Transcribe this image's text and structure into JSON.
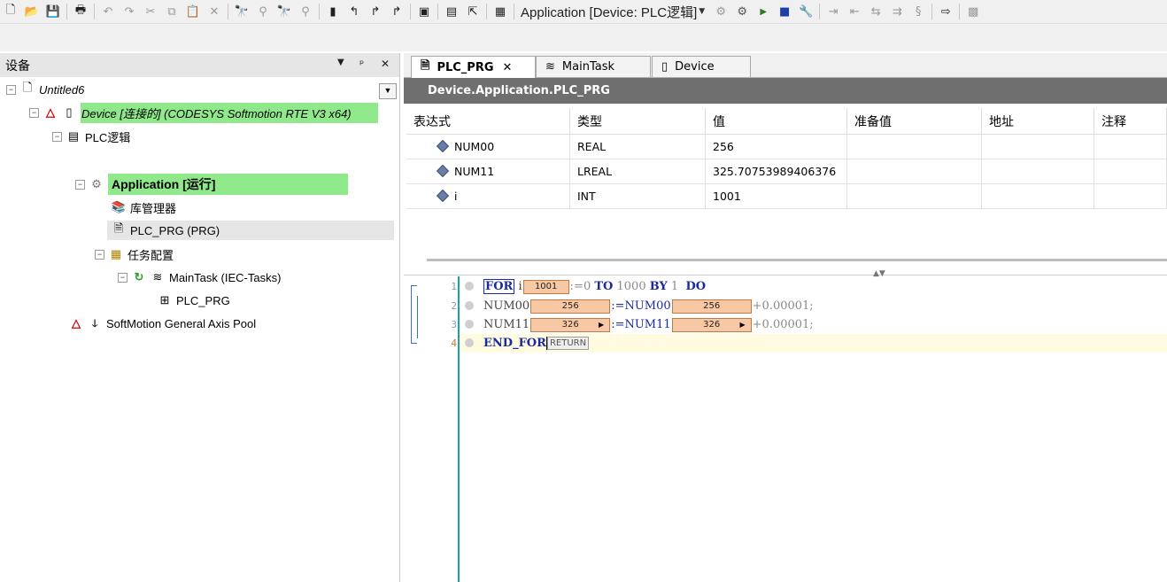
{
  "toolbar": {
    "application_selector": "Application [Device: PLC逻辑]"
  },
  "devices_pane": {
    "title": "设备",
    "controls": {
      "dropdown": "▼",
      "pin": "ᵖ",
      "close": "✕"
    },
    "tree": [
      {
        "label": "Untitled6"
      },
      {
        "label": "Device [连接的] (CODESYS Softmotion RTE V3 x64)"
      },
      {
        "label": "PLC逻辑"
      },
      {
        "label": "Application [运行]"
      },
      {
        "label": "库管理器"
      },
      {
        "label": "PLC_PRG (PRG)"
      },
      {
        "label": "任务配置"
      },
      {
        "label": "MainTask (IEC-Tasks)"
      },
      {
        "label": "PLC_PRG"
      },
      {
        "label": "SoftMotion General Axis Pool"
      }
    ]
  },
  "editor": {
    "tabs": [
      {
        "label": "PLC_PRG",
        "close": "✕"
      },
      {
        "label": "MainTask"
      },
      {
        "label": "Device"
      }
    ],
    "path": "Device.Application.PLC_PRG",
    "watch_headers": [
      "表达式",
      "类型",
      "值",
      "准备值",
      "地址",
      "注释"
    ],
    "watch_rows": [
      {
        "expr": "NUM00",
        "type": "REAL",
        "value": "256",
        "prep": "",
        "addr": "",
        "comment": ""
      },
      {
        "expr": "NUM11",
        "type": "LREAL",
        "value": "325.70753989406376",
        "prep": "",
        "addr": "",
        "comment": ""
      },
      {
        "expr": "i",
        "type": "INT",
        "value": "1001",
        "prep": "",
        "addr": "",
        "comment": ""
      }
    ],
    "code": {
      "line_numbers": [
        "1",
        "2",
        "3",
        "4"
      ],
      "l1": {
        "for": "FOR",
        "i": "i",
        "mon_i": "1001",
        "assign": ":=0",
        "to": "TO",
        "end": "1000",
        "by": "BY",
        "step": "1",
        "do": "DO"
      },
      "l2": {
        "lhs": "NUM00",
        "mon_lhs": "256",
        "assign": ":=NUM00",
        "mon_rhs": "256",
        "inc": "+0.00001;"
      },
      "l3": {
        "lhs": "NUM11",
        "mon_lhs": "326",
        "assign": ":=NUM11",
        "mon_rhs": "326",
        "inc": "+0.00001;"
      },
      "l4": {
        "end_for": "END_FOR",
        "return": "RETURN"
      }
    }
  }
}
